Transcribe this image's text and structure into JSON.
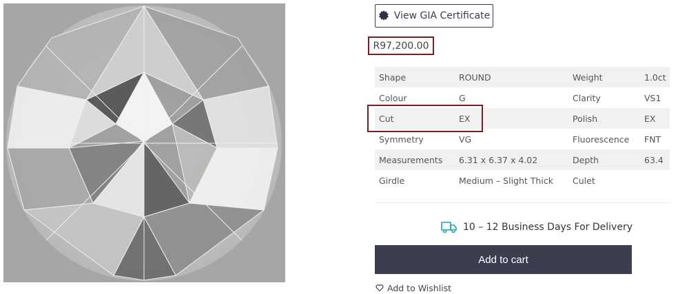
{
  "product": {
    "image_alt": "round-diamond-image"
  },
  "gia_button": {
    "label": "View GIA Certificate",
    "icon": "gia-badge-icon"
  },
  "price": "R97,200.00",
  "specs": [
    {
      "label1": "Shape",
      "value1": "ROUND",
      "label2": "Weight",
      "value2": "1.0ct"
    },
    {
      "label1": "Colour",
      "value1": "G",
      "label2": "Clarity",
      "value2": "VS1"
    },
    {
      "label1": "Cut",
      "value1": "EX",
      "label2": "Polish",
      "value2": "EX"
    },
    {
      "label1": "Symmetry",
      "value1": "VG",
      "label2": "Fluorescence",
      "value2": "FNT"
    },
    {
      "label1": "Measurements",
      "value1": "6.31 x 6.37 x 4.02",
      "label2": "Depth",
      "value2": "63.4"
    },
    {
      "label1": "Girdle",
      "value1": "Medium – Slight Thick",
      "label2": "Culet",
      "value2": ""
    }
  ],
  "delivery": {
    "text": "10 – 12 Business Days For Delivery",
    "icon": "truck-icon",
    "icon_color": "#1aa7b0"
  },
  "cart_button": {
    "label": "Add to cart",
    "bg_color": "#3b3e4f"
  },
  "wishlist": {
    "label": "Add to Wishlist",
    "icon": "heart-icon"
  },
  "accent_color": "#7b1c22"
}
